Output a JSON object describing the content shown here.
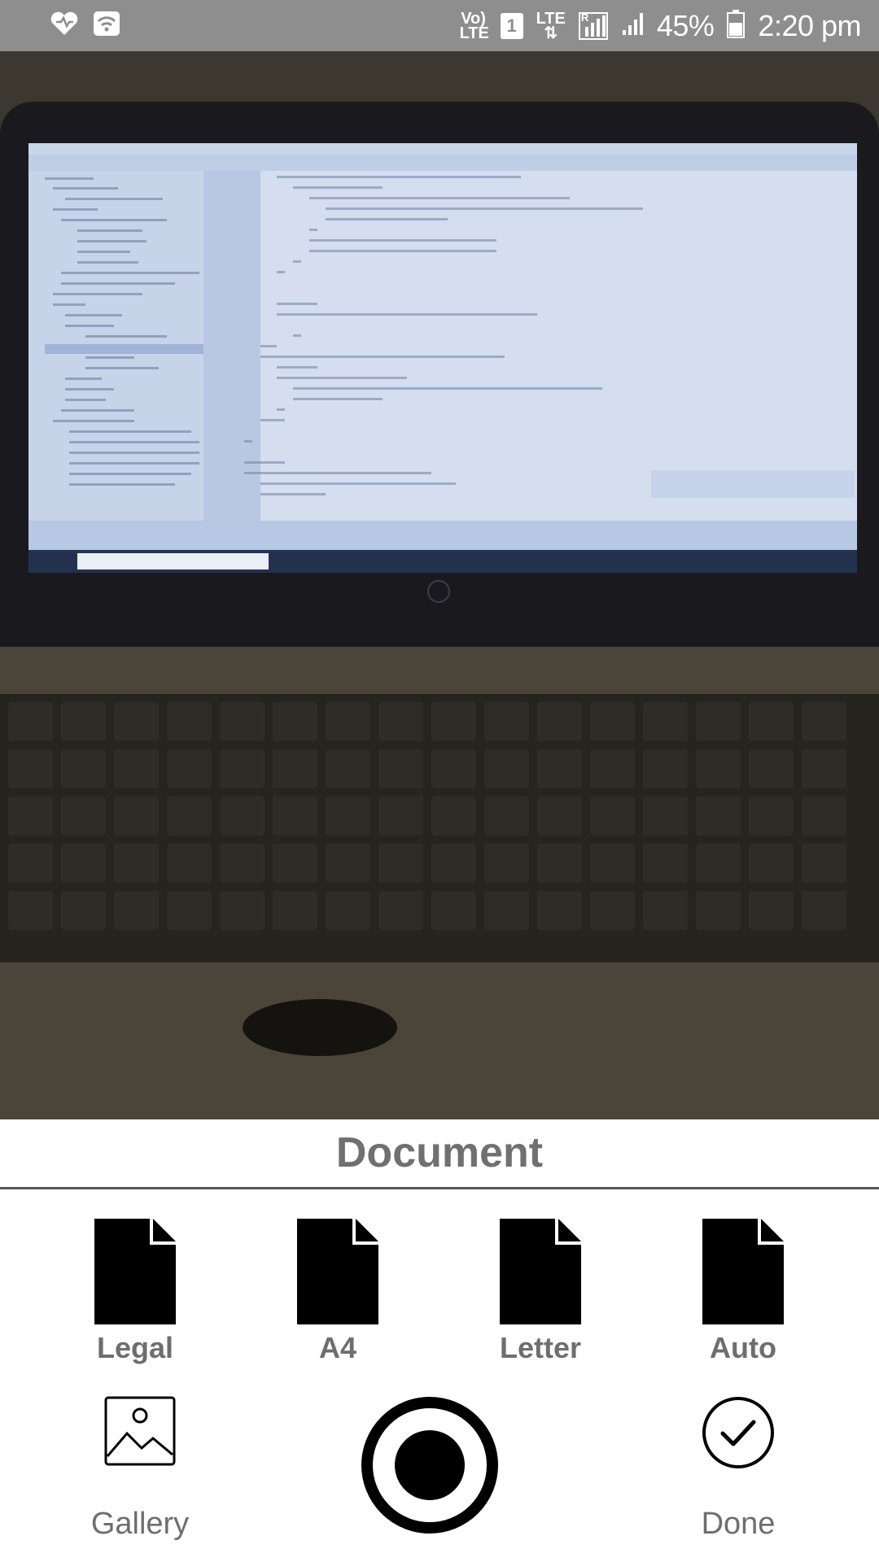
{
  "status_bar": {
    "network_label": "Vo) LTE",
    "sim_slot": "1",
    "lte_label": "LTE",
    "roaming_label": "R",
    "battery_percent": "45%",
    "time": "2:20 pm",
    "icons": [
      "health-heart-icon",
      "wifi-icon",
      "volte-icon",
      "sim-icon",
      "lte-data-icon",
      "signal-r-icon",
      "signal-icon",
      "battery-icon"
    ]
  },
  "camera_preview": {
    "description_icon": "camera-viewfinder"
  },
  "sheet": {
    "title": "Document",
    "formats": [
      {
        "label": "Legal",
        "icon": "page-icon"
      },
      {
        "label": "A4",
        "icon": "page-icon"
      },
      {
        "label": "Letter",
        "icon": "page-icon"
      },
      {
        "label": "Auto",
        "icon": "page-icon"
      }
    ],
    "gallery_label": "Gallery",
    "done_label": "Done",
    "capture_icon": "shutter-icon"
  },
  "colors": {
    "status_bar_bg": "#8e8e8e",
    "label_gray": "#6e6e6e",
    "icon_black": "#000000"
  }
}
